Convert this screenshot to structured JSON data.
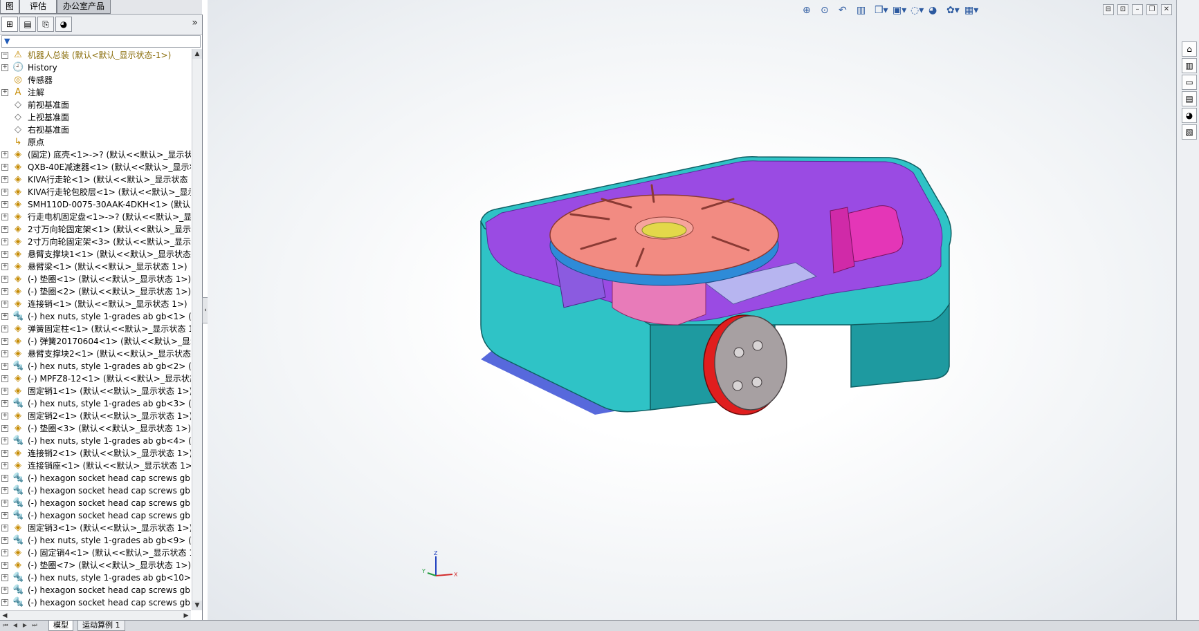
{
  "tabs": [
    {
      "label": "图",
      "active": false
    },
    {
      "label": "评估",
      "active": false
    },
    {
      "label": "办公室产品",
      "active": true
    }
  ],
  "manager_tabs": [
    {
      "icon": "feature-tree-icon",
      "glyph": "⊞"
    },
    {
      "icon": "property-manager-icon",
      "glyph": "▤"
    },
    {
      "icon": "configuration-manager-icon",
      "glyph": "⎘"
    },
    {
      "icon": "display-manager-icon",
      "glyph": "◕"
    }
  ],
  "expand_label": "»",
  "tree": [
    {
      "label": "机器人总装  (默认<默认_显示状态-1>)",
      "icon": "assembly-warning-icon",
      "glyph": "⚠",
      "expand": "−",
      "root": true
    },
    {
      "label": "History",
      "icon": "history-icon",
      "glyph": "🕘",
      "expand": "+"
    },
    {
      "label": "传感器",
      "icon": "sensor-icon",
      "glyph": "◎",
      "expand": ""
    },
    {
      "label": "注解",
      "icon": "annotation-icon",
      "glyph": "A",
      "expand": "+"
    },
    {
      "label": "前视基准面",
      "icon": "plane-icon",
      "glyph": "◇",
      "expand": ""
    },
    {
      "label": "上视基准面",
      "icon": "plane-icon",
      "glyph": "◇",
      "expand": ""
    },
    {
      "label": "右视基准面",
      "icon": "plane-icon",
      "glyph": "◇",
      "expand": ""
    },
    {
      "label": "原点",
      "icon": "origin-icon",
      "glyph": "↳",
      "expand": ""
    },
    {
      "label": "(固定) 底壳<1>->? (默认<<默认>_显示状态",
      "icon": "part-icon",
      "glyph": "◈",
      "expand": "+"
    },
    {
      "label": "QXB-40E减速器<1> (默认<<默认>_显示状",
      "icon": "part-icon",
      "glyph": "◈",
      "expand": "+"
    },
    {
      "label": "KIVA行走轮<1> (默认<<默认>_显示状态 1",
      "icon": "part-icon",
      "glyph": "◈",
      "expand": "+"
    },
    {
      "label": "KIVA行走轮包胶层<1> (默认<<默认>_显示",
      "icon": "part-icon",
      "glyph": "◈",
      "expand": "+"
    },
    {
      "label": "SMH110D-0075-30AAK-4DKH<1> (默认<",
      "icon": "part-icon",
      "glyph": "◈",
      "expand": "+"
    },
    {
      "label": "行走电机固定盘<1>->? (默认<<默认>_显示",
      "icon": "part-icon",
      "glyph": "◈",
      "expand": "+"
    },
    {
      "label": "2寸万向轮固定架<1> (默认<<默认>_显示状",
      "icon": "part-icon",
      "glyph": "◈",
      "expand": "+"
    },
    {
      "label": "2寸万向轮固定架<3> (默认<<默认>_显示状",
      "icon": "part-icon",
      "glyph": "◈",
      "expand": "+"
    },
    {
      "label": "悬臂支撑块1<1> (默认<<默认>_显示状态 1",
      "icon": "part-icon",
      "glyph": "◈",
      "expand": "+"
    },
    {
      "label": "悬臂梁<1> (默认<<默认>_显示状态 1>)",
      "icon": "part-icon",
      "glyph": "◈",
      "expand": "+"
    },
    {
      "label": "(-) 垫圈<1> (默认<<默认>_显示状态 1>)",
      "icon": "part-icon",
      "glyph": "◈",
      "expand": "+"
    },
    {
      "label": "(-) 垫圈<2> (默认<<默认>_显示状态 1>)",
      "icon": "part-icon",
      "glyph": "◈",
      "expand": "+"
    },
    {
      "label": "连接销<1> (默认<<默认>_显示状态 1>)",
      "icon": "part-icon",
      "glyph": "◈",
      "expand": "+"
    },
    {
      "label": "(-) hex nuts, style 1-grades ab gb<1> (G",
      "icon": "toolbox-part-icon",
      "glyph": "🔩",
      "expand": "+"
    },
    {
      "label": "弹簧固定柱<1> (默认<<默认>_显示状态 1>",
      "icon": "part-icon",
      "glyph": "◈",
      "expand": "+"
    },
    {
      "label": "(-) 弹簧20170604<1> (默认<<默认>_显示",
      "icon": "part-icon",
      "glyph": "◈",
      "expand": "+"
    },
    {
      "label": "悬臂支撑块2<1> (默认<<默认>_显示状态 1",
      "icon": "part-icon",
      "glyph": "◈",
      "expand": "+"
    },
    {
      "label": "(-) hex nuts, style 1-grades ab gb<2> (G",
      "icon": "toolbox-part-icon",
      "glyph": "🔩",
      "expand": "+"
    },
    {
      "label": "(-) MPFZ8-12<1> (默认<<默认>_显示状态",
      "icon": "part-icon",
      "glyph": "◈",
      "expand": "+"
    },
    {
      "label": "固定销1<1> (默认<<默认>_显示状态 1>)",
      "icon": "part-icon",
      "glyph": "◈",
      "expand": "+"
    },
    {
      "label": "(-) hex nuts, style 1-grades ab gb<3> (G",
      "icon": "toolbox-part-icon",
      "glyph": "🔩",
      "expand": "+"
    },
    {
      "label": "固定销2<1> (默认<<默认>_显示状态 1>)",
      "icon": "part-icon",
      "glyph": "◈",
      "expand": "+"
    },
    {
      "label": "(-) 垫圈<3> (默认<<默认>_显示状态 1>)",
      "icon": "part-icon",
      "glyph": "◈",
      "expand": "+"
    },
    {
      "label": "(-) hex nuts, style 1-grades ab gb<4> (G",
      "icon": "toolbox-part-icon",
      "glyph": "🔩",
      "expand": "+"
    },
    {
      "label": "连接销2<1> (默认<<默认>_显示状态 1>)",
      "icon": "part-icon",
      "glyph": "◈",
      "expand": "+"
    },
    {
      "label": "连接销座<1> (默认<<默认>_显示状态 1>)",
      "icon": "part-icon",
      "glyph": "◈",
      "expand": "+"
    },
    {
      "label": "(-) hexagon socket head cap screws gb<",
      "icon": "toolbox-part-icon",
      "glyph": "🔩",
      "expand": "+"
    },
    {
      "label": "(-) hexagon socket head cap screws gb<",
      "icon": "toolbox-part-icon",
      "glyph": "🔩",
      "expand": "+"
    },
    {
      "label": "(-) hexagon socket head cap screws gb<",
      "icon": "toolbox-part-icon",
      "glyph": "🔩",
      "expand": "+"
    },
    {
      "label": "(-) hexagon socket head cap screws gb<",
      "icon": "toolbox-part-icon",
      "glyph": "🔩",
      "expand": "+"
    },
    {
      "label": "固定销3<1> (默认<<默认>_显示状态 1>)",
      "icon": "part-icon",
      "glyph": "◈",
      "expand": "+"
    },
    {
      "label": "(-) hex nuts, style 1-grades ab gb<9> (G",
      "icon": "toolbox-part-icon",
      "glyph": "🔩",
      "expand": "+"
    },
    {
      "label": "(-) 固定销4<1> (默认<<默认>_显示状态 1>",
      "icon": "part-icon",
      "glyph": "◈",
      "expand": "+"
    },
    {
      "label": "(-) 垫圈<7> (默认<<默认>_显示状态 1>)",
      "icon": "part-icon",
      "glyph": "◈",
      "expand": "+"
    },
    {
      "label": "(-) hex nuts, style 1-grades ab gb<10> (",
      "icon": "toolbox-part-icon",
      "glyph": "🔩",
      "expand": "+"
    },
    {
      "label": "(-) hexagon socket head cap screws gb<",
      "icon": "toolbox-part-icon",
      "glyph": "🔩",
      "expand": "+"
    },
    {
      "label": "(-) hexagon socket head cap screws gb<",
      "icon": "toolbox-part-icon",
      "glyph": "🔩",
      "expand": "+"
    }
  ],
  "heads_up_toolbar": [
    {
      "icon": "zoom-to-fit-icon",
      "glyph": "⊕"
    },
    {
      "icon": "zoom-to-area-icon",
      "glyph": "⊙"
    },
    {
      "icon": "previous-view-icon",
      "glyph": "↶"
    },
    {
      "icon": "section-view-icon",
      "glyph": "▥"
    },
    {
      "icon": "view-orientation-icon",
      "glyph": "❒▾"
    },
    {
      "icon": "display-style-icon",
      "glyph": "▣▾"
    },
    {
      "icon": "hide-show-items-icon",
      "glyph": "◌▾"
    },
    {
      "icon": "edit-appearance-icon",
      "glyph": "◕"
    },
    {
      "icon": "apply-scene-icon",
      "glyph": "✿▾"
    },
    {
      "icon": "view-settings-icon",
      "glyph": "▦▾"
    }
  ],
  "window_controls": [
    {
      "icon": "tile-icon",
      "glyph": "⊟"
    },
    {
      "icon": "tile-alt-icon",
      "glyph": "⊡"
    },
    {
      "icon": "minimize-icon",
      "glyph": "–"
    },
    {
      "icon": "restore-icon",
      "glyph": "❐"
    },
    {
      "icon": "close-icon",
      "glyph": "✕"
    }
  ],
  "task_pane": [
    {
      "icon": "solidworks-resources-icon",
      "glyph": "⌂"
    },
    {
      "icon": "design-library-icon",
      "glyph": "▥"
    },
    {
      "icon": "file-explorer-icon",
      "glyph": "▭"
    },
    {
      "icon": "view-palette-icon",
      "glyph": "▤"
    },
    {
      "icon": "appearances-icon",
      "glyph": "◕"
    },
    {
      "icon": "custom-properties-icon",
      "glyph": "▧"
    }
  ],
  "triad": {
    "x": "X",
    "y": "Y",
    "z": "Z"
  },
  "bottom_tabs": [
    {
      "label": "模型",
      "active": true
    },
    {
      "label": "运动算例 1",
      "active": false
    }
  ],
  "colors": {
    "shell": "#2fc3c6",
    "shell_dark": "#1e9aa0",
    "inner": "#9a4be3",
    "turntable": "#f28b82",
    "motor": "#e436b7",
    "wheel": "#e01e1e",
    "hub": "#a7a0a2"
  }
}
